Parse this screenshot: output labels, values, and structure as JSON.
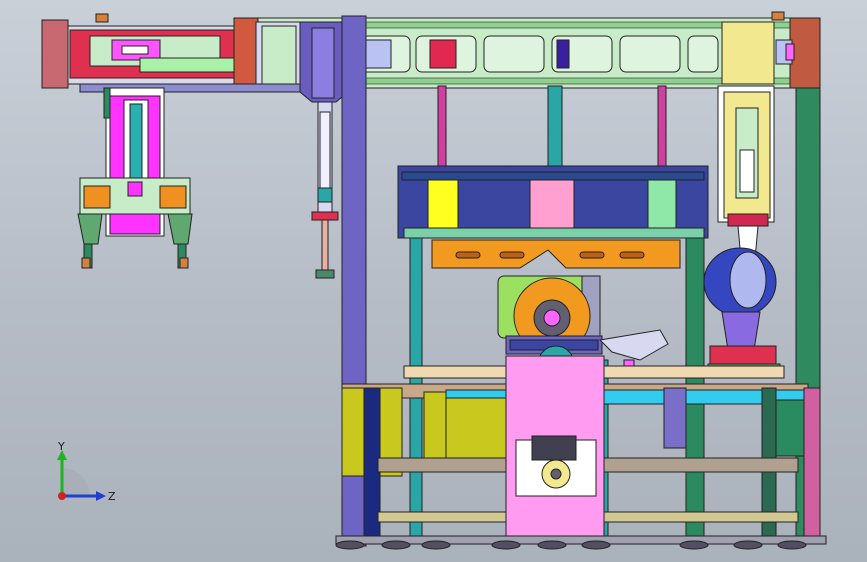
{
  "view": {
    "triad": {
      "y_label": "Y",
      "z_label": "Z"
    }
  },
  "colors": {
    "background": "#bcc3cc",
    "frame_purple": "#7a6fc8",
    "frame_green": "#2f9a73",
    "magenta": "#ff33ff",
    "pink": "#ff9bd6",
    "orange": "#f29a20",
    "yellow": "#c8c81e",
    "teal": "#2aa6a6",
    "cyan_bar": "#33ccee",
    "navy": "#1a2a80",
    "rail_green": "#b8e8b8"
  }
}
